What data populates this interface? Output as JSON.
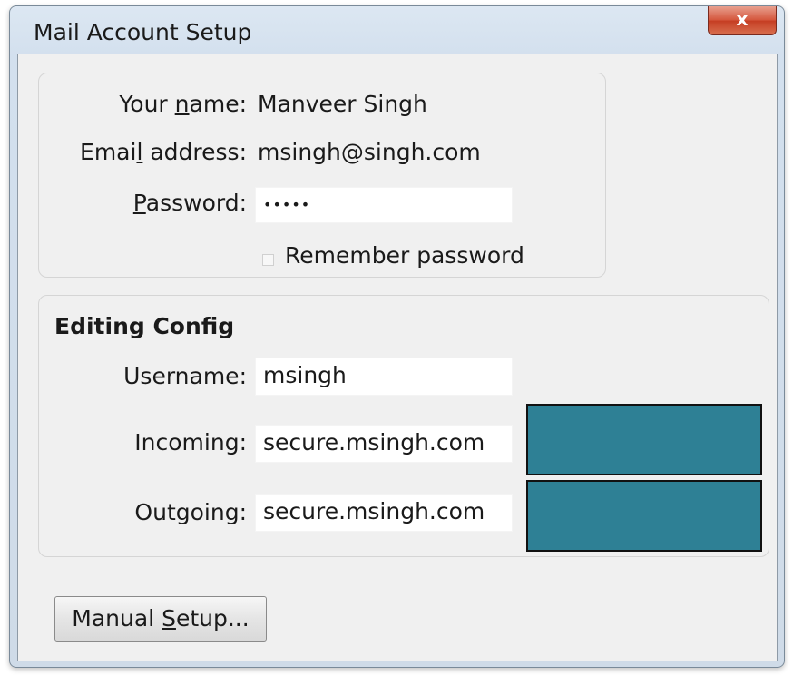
{
  "window": {
    "title": "Mail Account Setup",
    "close_label": "x"
  },
  "account": {
    "name_label_pre": "Your ",
    "name_label_accel": "n",
    "name_label_post": "ame:",
    "name_value": "Manveer Singh",
    "email_label_pre": "Emai",
    "email_label_accel": "l",
    "email_label_post": " address:",
    "email_value": "msingh@singh.com",
    "password_label_accel": "P",
    "password_label_post": "assword:",
    "password_value": "•••••",
    "remember_label": "Remember password",
    "remember_checked": false
  },
  "config": {
    "title": "Editing Config",
    "username_label": "Username:",
    "username_value": "msingh",
    "incoming_label": "Incoming:",
    "incoming_value": "secure.msingh.com",
    "outgoing_label": "Outgoing:",
    "outgoing_value": "secure.msingh.com",
    "redaction_color": "#2e8095"
  },
  "buttons": {
    "manual_pre": "Manual ",
    "manual_accel": "S",
    "manual_post": "etup..."
  }
}
